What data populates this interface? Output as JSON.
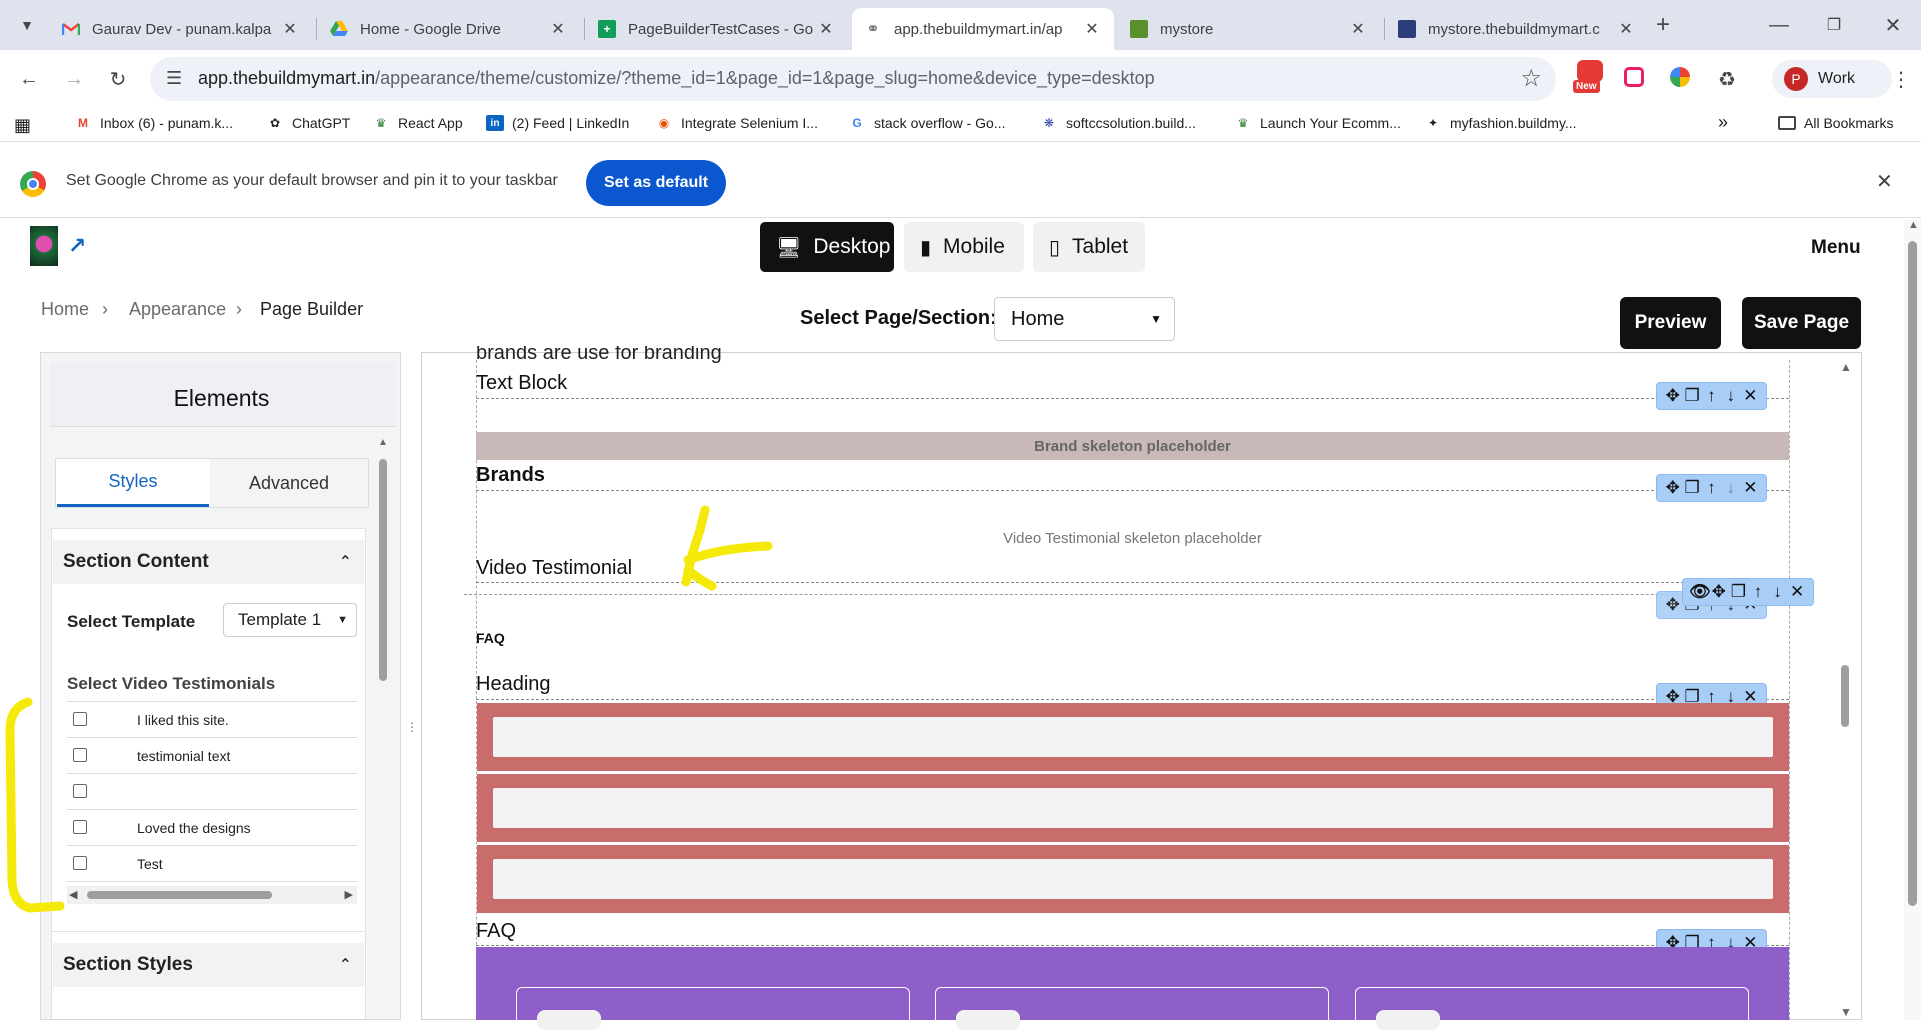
{
  "browser": {
    "tabs": [
      {
        "title": "Gaurav Dev - punam.kalpa",
        "favicon": "gmail-icon"
      },
      {
        "title": "Home - Google Drive",
        "favicon": "drive-icon"
      },
      {
        "title": "PageBuilderTestCases - Go",
        "favicon": "sheets-icon"
      },
      {
        "title": "app.thebuildmymart.in/ap",
        "favicon": "globe-icon"
      },
      {
        "title": "mystore",
        "favicon": "store-icon"
      },
      {
        "title": "mystore.thebuildmymart.c",
        "favicon": "site-icon"
      }
    ],
    "url_host": "app.thebuildmymart.in",
    "url_path": "/appearance/theme/customize/?theme_id=1&page_id=1&page_slug=home&device_type=desktop",
    "profile_label": "Work",
    "profile_initial": "P",
    "new_badge": "New",
    "bookmarks": [
      "Inbox (6) - punam.k...",
      "ChatGPT",
      "React App",
      "(2) Feed | LinkedIn",
      "Integrate Selenium I...",
      "stack overflow - Go...",
      "softccsolution.build...",
      "Launch Your Ecomm...",
      "myfashion.buildmy..."
    ],
    "all_bookmarks": "All Bookmarks",
    "infobar_message": "Set Google Chrome as your default browser and pin it to your taskbar",
    "infobar_button": "Set as default"
  },
  "app": {
    "devices": [
      "Desktop",
      "Mobile",
      "Tablet"
    ],
    "menu_label": "Menu",
    "breadcrumb": [
      "Home",
      "Appearance",
      "Page Builder"
    ],
    "select_page_label": "Select Page/Section:",
    "select_page_value": "Home",
    "preview_label": "Preview",
    "save_label": "Save Page"
  },
  "panel": {
    "title": "Elements",
    "tabs": [
      "Styles",
      "Advanced"
    ],
    "section_content": "Section Content",
    "select_template_label": "Select Template",
    "select_template_value": "Template 1",
    "select_testimonials_label": "Select Video Testimonials",
    "testimonials": [
      "I liked this site.",
      "testimonial text",
      "",
      "Loved the designs",
      "Test"
    ],
    "section_styles": "Section Styles"
  },
  "canvas": {
    "cut_text": "brands are use for branding",
    "text_block": "Text Block",
    "brand_placeholder": "Brand skeleton placeholder",
    "brands": "Brands",
    "video_placeholder": "Video Testimonial skeleton placeholder",
    "video_testimonial": "Video Testimonial",
    "faq_small": "FAQ",
    "heading": "Heading",
    "faq": "FAQ"
  },
  "colors": {
    "brand_placeholder_bg": "#c9b8b8",
    "faq_bar": "#c86c6c",
    "faq_purple": "#8e5fc9",
    "control_bar": "#a8cef7",
    "annotation_yellow": "#f5e90a",
    "accent_blue": "#1565c0"
  }
}
